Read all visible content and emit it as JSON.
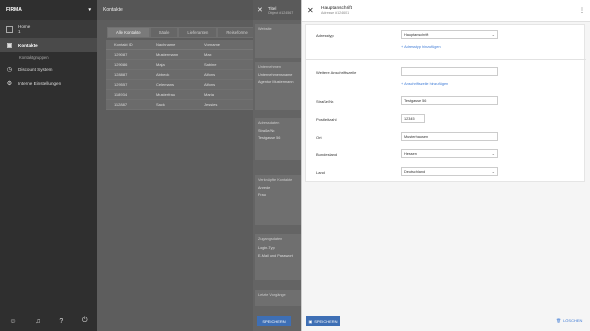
{
  "sidebar": {
    "company": "FIRMA",
    "home_line1": "Home",
    "home_line2": "1",
    "items": [
      {
        "label": "Kontakte",
        "icon": "contacts-icon"
      },
      {
        "label": "Discount System",
        "icon": "clock-icon"
      },
      {
        "label": "Interne Einstellungen",
        "icon": "gear-icon"
      }
    ],
    "sub_item": "Kontaktgruppen"
  },
  "main": {
    "title": "Kontakte",
    "tabs": [
      "Alle Kontakte",
      "Säale",
      "Lieferanten",
      "Reiseforme"
    ],
    "columns": [
      "Kontakt ID",
      "Nachname",
      "Vorname"
    ],
    "rows": [
      [
        "129087",
        "Mustermann",
        "Max"
      ],
      [
        "129086",
        "Maja",
        "Sabine"
      ],
      [
        "128887",
        "Abbeck",
        "Alfons"
      ],
      [
        "129557",
        "Celemans",
        "Alfons"
      ],
      [
        "118934",
        "Musterfrau",
        "Maria"
      ],
      [
        "112887",
        "Sack",
        "Jessies"
      ]
    ]
  },
  "mid": {
    "title": "Titel",
    "subtitle": "Object #124567",
    "cards": [
      {
        "label": "Website",
        "value": ""
      },
      {
        "label": "Unternehmen",
        "value": "Unternehmensname\nAgentur Mustermann"
      },
      {
        "label": "Adressdaten",
        "value": "Straße/Nr.\nTestgasse 56"
      },
      {
        "label": "Verknüpfte Kontakte",
        "value": "Anrede\nFrau"
      },
      {
        "label": "Zugangsdaten",
        "value": "Login-Typ\nE-Mail und Passwort"
      },
      {
        "label": "Letzte Vorgänge",
        "value": ""
      }
    ],
    "save_label": "SPEICHERN"
  },
  "panel": {
    "title": "Hauptanschrift",
    "subtitle": "Adresse #124601",
    "fields": {
      "adresstyp_label": "Adresstyp",
      "adresstyp_value": "Hauptanschrift",
      "add_type_link": "+ Adresstyp hinzufügen",
      "weitere_label": "Weitere Anschriftszeile",
      "weitere_value": "",
      "add_line_link": "+ Anschriftszeile hinzufügen",
      "strasse_label": "Straße/Nr.",
      "strasse_value": "Testgasse 56",
      "plz_label": "Postleitzahl",
      "plz_value": "12345",
      "ort_label": "Ort",
      "ort_value": "Musterhausen",
      "bundesland_label": "Bundesland",
      "bundesland_value": "Hessen",
      "land_label": "Land",
      "land_value": "Deutschland"
    },
    "save_label": "SPEICHERN",
    "delete_label": "LÖSCHEN"
  }
}
